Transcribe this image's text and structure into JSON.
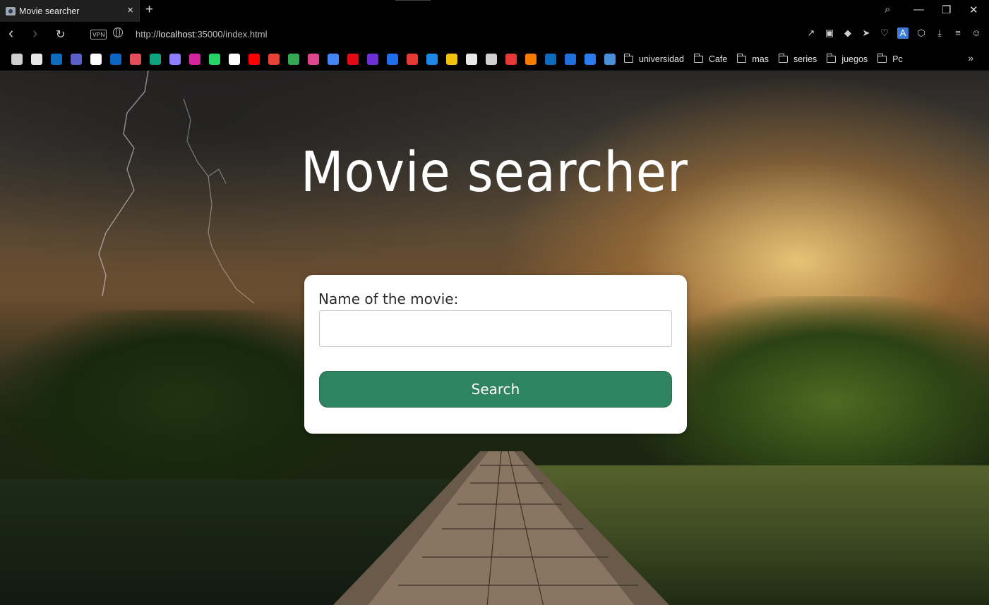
{
  "browser": {
    "tab": {
      "title": "Movie searcher",
      "favicon": "camera-icon"
    },
    "new_tab_label": "+",
    "window_controls": {
      "search": "⌕",
      "minimize": "—",
      "restore": "❐",
      "close": "✕"
    },
    "nav": {
      "back": "‹",
      "forward": "›",
      "reload": "↻"
    },
    "vpn_label": "VPN",
    "url_prefix": "http://",
    "url_host": "localhost",
    "url_rest": ":35000/index.html",
    "right_icons": [
      "share-icon",
      "camera-icon",
      "shield-icon",
      "send-icon",
      "heart-icon",
      "translate-icon",
      "cube-icon",
      "download-icon",
      "menu-icon",
      "profile-icon"
    ],
    "bookmark_icon_colors": [
      "#cfcfcf",
      "#e8e8e8",
      "#0f6cbd",
      "#5b5fc7",
      "#ffffff",
      "#0a66c2",
      "#e44d5b",
      "#10a37f",
      "#8e7dff",
      "#d6249f",
      "#25d366",
      "#ffffff",
      "#ff0000",
      "#ea4335",
      "#34a853",
      "#e0458f",
      "#4285f4",
      "#e50914",
      "#6b2fd6",
      "#1f6feb",
      "#e53935",
      "#1e88e5",
      "#f4c20d",
      "#e8e8e8",
      "#cfcfcf",
      "#e53935",
      "#f57c00",
      "#0f6cbd",
      "#1e6fd9",
      "#2d7bf0",
      "#4a90d9"
    ],
    "bookmark_folders": [
      "universidad",
      "Cafe",
      "mas",
      "series",
      "juegos",
      "Pc"
    ],
    "more_label": "»"
  },
  "page": {
    "title": "Movie searcher",
    "form": {
      "label": "Name of the movie:",
      "input_value": "",
      "input_placeholder": "",
      "button_label": "Search",
      "button_color": "#2e8460"
    }
  }
}
